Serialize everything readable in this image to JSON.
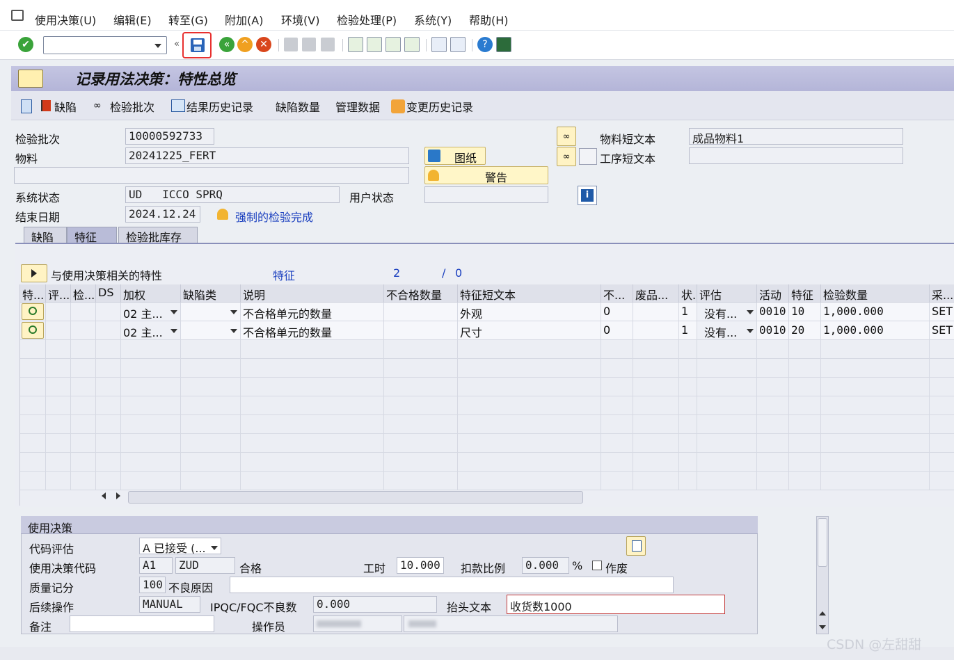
{
  "menu": {
    "items": [
      "使用决策(U)",
      "编辑(E)",
      "转至(G)",
      "附加(A)",
      "环境(V)",
      "检验处理(P)",
      "系统(Y)",
      "帮助(H)"
    ]
  },
  "title": "记录用法决策：特性总览",
  "app_toolbar": {
    "defect": "缺陷",
    "inspection_lot": "检验批次",
    "result_history": "结果历史记录",
    "defect_count": "缺陷数量",
    "admin_data": "管理数据",
    "change_history": "变更历史记录"
  },
  "header": {
    "inspection_lot_label": "检验批次",
    "inspection_lot": "10000592733",
    "material_label": "物料",
    "material": "20241225_FERT",
    "system_status_label": "系统状态",
    "system_status": "UD   ICCO SPRQ",
    "end_date_label": "结束日期",
    "end_date": "2024.12.24",
    "forced_completion": "强制的检验完成",
    "drawing_button": "图纸",
    "warning_button": "警告",
    "user_status_label": "用户状态",
    "user_status": "",
    "material_text_label": "物料短文本",
    "material_text": "成品物料1",
    "operation_text_label": "工序短文本",
    "operation_text": ""
  },
  "tabs": [
    "缺陷",
    "特征",
    "检验批库存"
  ],
  "char_section": {
    "label": "与使用决策相关的特性",
    "feature_label": "特征",
    "count": "2",
    "slash": "/",
    "total": "0"
  },
  "table": {
    "columns": [
      "特...",
      "评...",
      "检...",
      "DS",
      "加权",
      "缺陷类",
      "说明",
      "不合格数量",
      "特征短文本",
      "不...",
      "废品...",
      "状.",
      "评估",
      "活动",
      "特征",
      "检验数量",
      "采..."
    ],
    "rows": [
      {
        "weight": "02 主...",
        "defect_class": "",
        "desc": "不合格单元的数量",
        "nonconf": "",
        "short_text": "外观",
        "n": "0",
        "scrap": "",
        "status": "1",
        "eval": "没有...",
        "activity": "0010",
        "char": "10",
        "qty": "1,000.000",
        "sample": "SET"
      },
      {
        "weight": "02 主...",
        "defect_class": "",
        "desc": "不合格单元的数量",
        "nonconf": "",
        "short_text": "尺寸",
        "n": "0",
        "scrap": "",
        "status": "1",
        "eval": "没有...",
        "activity": "0010",
        "char": "20",
        "qty": "1,000.000",
        "sample": "SET"
      }
    ]
  },
  "usage_decision": {
    "title": "使用决策",
    "code_eval_label": "代码评估",
    "code_eval": "A 已接受 (...",
    "ud_code_label": "使用决策代码",
    "ud_code": "A1",
    "ud_code2": "ZUD",
    "ud_text": "合格",
    "work_hours_label": "工时",
    "work_hours": "10.000",
    "deduct_label": "扣款比例",
    "deduct": "0.000",
    "percent": "%",
    "void_label": "作废",
    "quality_score_label": "质量记分",
    "quality_score": "100",
    "bad_reason_label": "不良原因",
    "bad_reason": "",
    "followup_label": "后续操作",
    "followup": "MANUAL",
    "ipqc_label": "IPQC/FQC不良数",
    "ipqc": "0.000",
    "header_text_label": "抬头文本",
    "header_text": "收货数1000",
    "remark_label": "备注",
    "remark": "",
    "operator_label": "操作员"
  },
  "watermark": "CSDN @左甜甜",
  "colors": {
    "title_bar": "#b4b5d8",
    "link_blue": "#1a3fbf",
    "save_highlight": "#e8302f"
  }
}
